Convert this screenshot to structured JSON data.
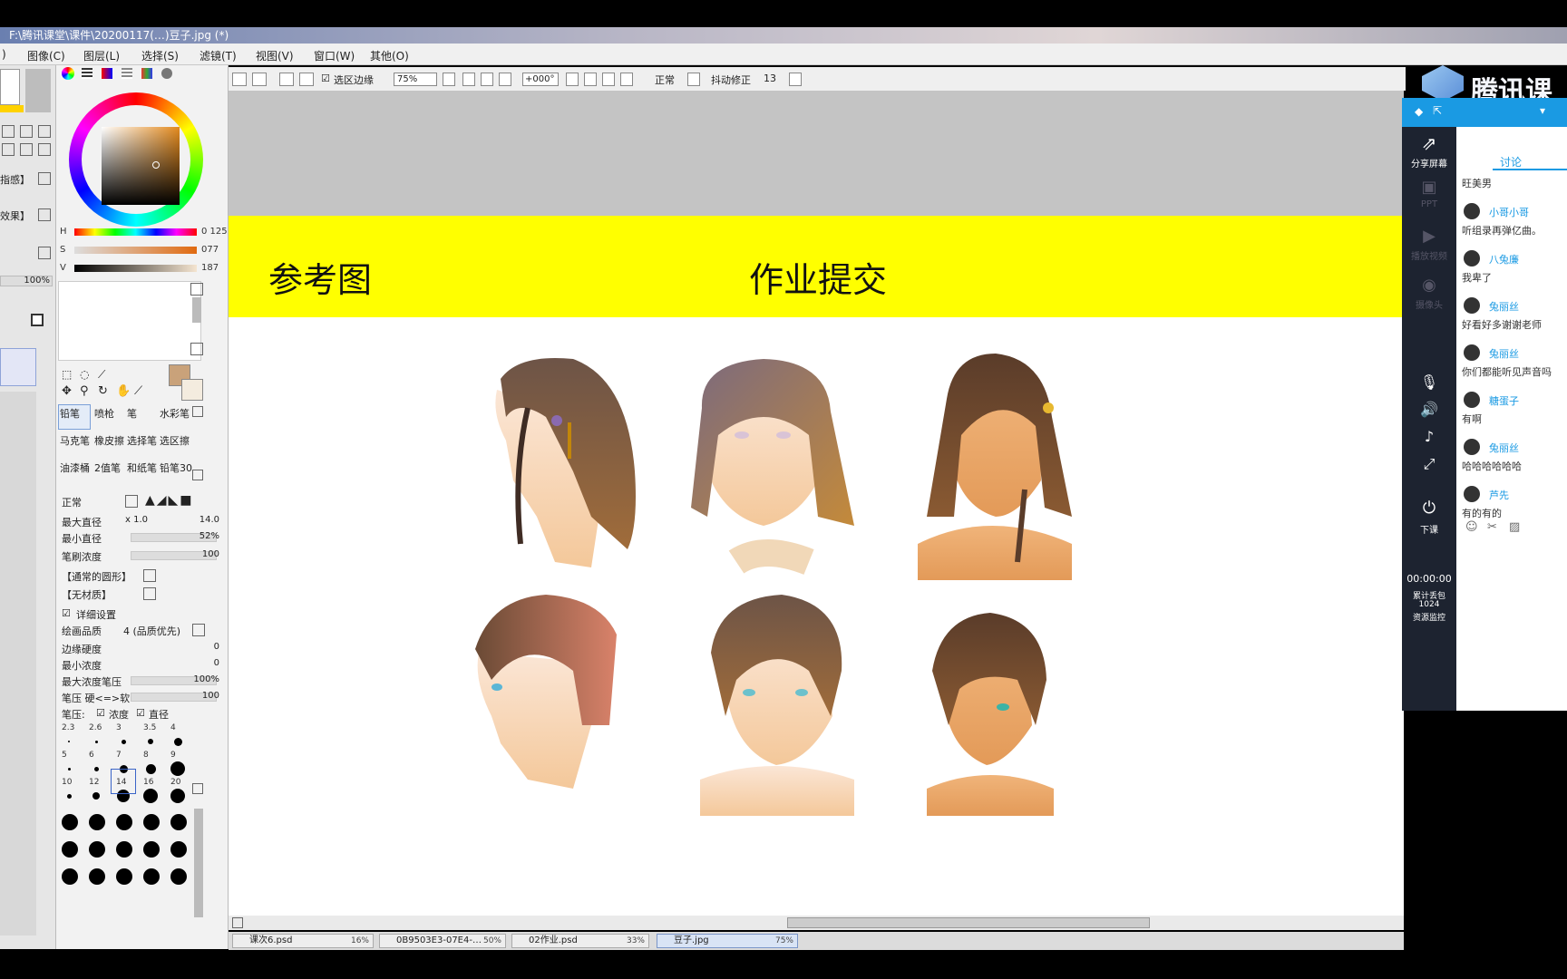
{
  "window": {
    "title": "F:\\腾讯课堂\\课件\\20200117(…)豆子.jpg (*)"
  },
  "menu": {
    "items": [
      "图像(C)",
      "图层(L)",
      "选择(S)",
      "滤镜(T)",
      "视图(V)",
      "窗口(W)",
      "其他(O)"
    ],
    "lead": ")"
  },
  "toolbar": {
    "selection_edge_label": "选区边缘",
    "zoom": "75%",
    "rotation": "+000°",
    "blend_mode": "正常",
    "stabilizer_label": "抖动修正",
    "stabilizer_value": "13"
  },
  "left_strip": {
    "item1": "指感】",
    "item2": "效果】",
    "opacity": "100%"
  },
  "color": {
    "h_label": "H",
    "h_value": "0 125",
    "s_label": "S",
    "s_value": "077",
    "v_label": "V",
    "v_value": "187",
    "primary_hex": "#c9a27a",
    "wheel_accent": "#e38a1e"
  },
  "tools": {
    "row1": [
      "铅笔",
      "喷枪",
      "笔",
      "水彩笔"
    ],
    "row2": [
      "马克笔",
      "橡皮擦",
      "选择笔",
      "选区擦"
    ],
    "row3": [
      "油漆桶",
      "2值笔",
      "和纸笔",
      "铅笔30"
    ]
  },
  "brush": {
    "mode": "正常",
    "max_diameter_label": "最大直径",
    "max_diameter_mult": "x 1.0",
    "max_diameter_value": "14.0",
    "min_diameter_label": "最小直径",
    "min_diameter_value": "52%",
    "density_label": "笔刷浓度",
    "density_value": "100",
    "shape_label": "【通常的圆形】",
    "texture_label": "【无材质】",
    "detail_label": "详细设置",
    "quality_label": "绘画品质",
    "quality_value": "4 (品质优先)",
    "edge_label": "边缘硬度",
    "edge_value": "0",
    "min_density_label": "最小浓度",
    "min_density_value": "0",
    "max_density_pressure_label": "最大浓度笔压",
    "max_density_pressure_value": "100%",
    "pressure_label": "笔压 硬<=>软",
    "pressure_value": "100",
    "pressure2_label": "笔压:",
    "pressure_density_label": "浓度",
    "pressure_diameter_label": "直径",
    "sizes_row1": [
      "2.3",
      "2.6",
      "3",
      "3.5",
      "4"
    ],
    "sizes_row2": [
      "5",
      "6",
      "7",
      "8",
      "9"
    ],
    "sizes_row3": [
      "10",
      "12",
      "14",
      "16",
      "20"
    ]
  },
  "canvas": {
    "heading_left": "参考图",
    "heading_right": "作业提交"
  },
  "file_tabs": [
    {
      "name": "课次6.psd",
      "zoom": "16%"
    },
    {
      "name": "0B9503E3-07E4-…",
      "zoom": "50%"
    },
    {
      "name": "02作业.psd",
      "zoom": "33%"
    },
    {
      "name": "豆子.jpg",
      "zoom": "75%"
    }
  ],
  "live": {
    "logo": "腾讯课",
    "side": {
      "share": "分享屏幕",
      "ppt": "PPT",
      "video": "播放视频",
      "camera": "摄像头",
      "end": "下课",
      "timer": "00:00:00",
      "stats_line1": "累计丢包",
      "stats_line2": "1024",
      "stats_line3": "资源监控"
    },
    "tab": "讨论",
    "messages": [
      {
        "name": "",
        "text": "旺美男"
      },
      {
        "name": "小哥小哥",
        "text": "听组录再弹亿曲。"
      },
      {
        "name": "八兔廉",
        "text": "我卑了"
      },
      {
        "name": "兔丽丝",
        "text": "好看好多谢谢老师"
      },
      {
        "name": "兔丽丝",
        "text": "你们都能听见声音吗"
      },
      {
        "name": "糖蛋子",
        "text": "有啊"
      },
      {
        "name": "兔丽丝",
        "text": "哈哈哈哈哈哈"
      },
      {
        "name": "芦先",
        "text": "有的有的"
      }
    ]
  }
}
